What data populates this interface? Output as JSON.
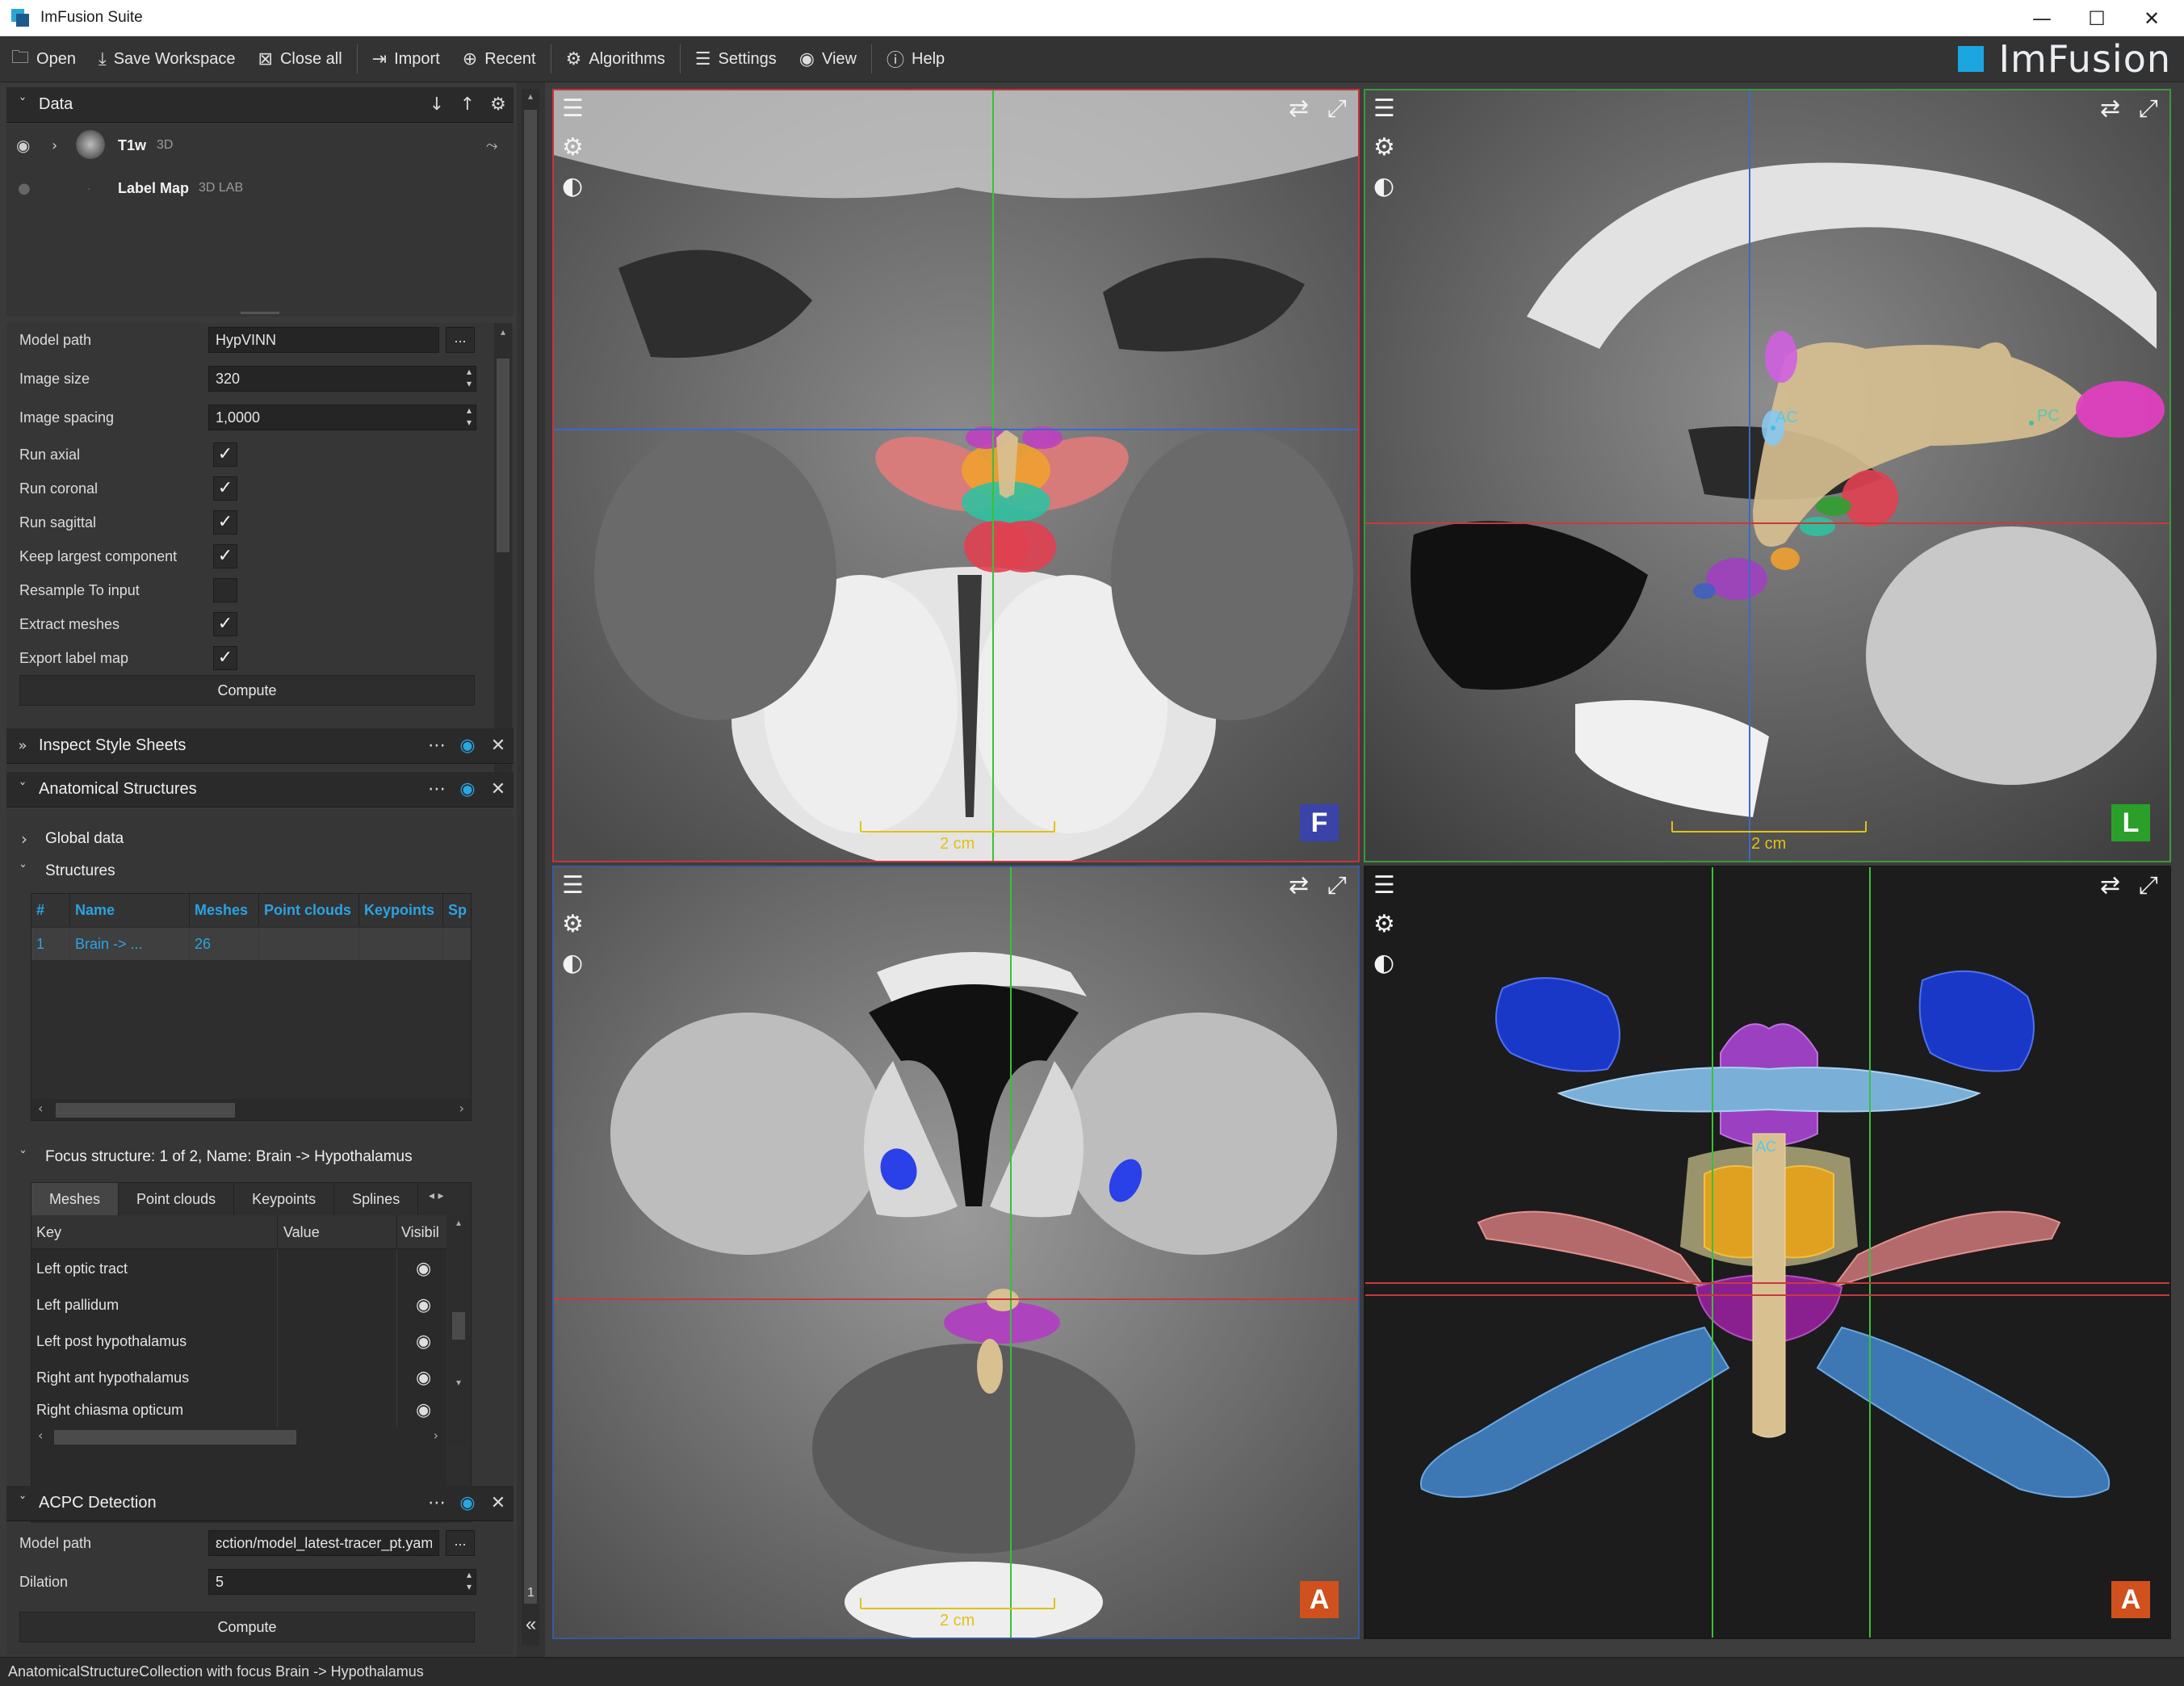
{
  "window": {
    "title": "ImFusion Suite",
    "minimize": "—",
    "maximize": "☐",
    "close": "✕"
  },
  "brand": {
    "name": "ImFusion",
    "accent": "#1ba6e0"
  },
  "toolbar": {
    "open": "Open",
    "save_workspace": "Save Workspace",
    "close_all": "Close all",
    "import": "Import",
    "recent": "Recent",
    "algorithms": "Algorithms",
    "settings": "Settings",
    "view": "View",
    "help": "Help"
  },
  "data_panel": {
    "title": "Data",
    "items": [
      {
        "name": "T1w",
        "tag": "3D",
        "icon": "brain-thumbnail-icon"
      },
      {
        "name": "Label Map",
        "tag": "3D LAB"
      }
    ]
  },
  "hypvinn": {
    "model_path_label": "Model path",
    "model_path": "HypVINN",
    "image_size_label": "Image size",
    "image_size": "320",
    "image_spacing_label": "Image spacing",
    "image_spacing": "1,0000",
    "options": [
      {
        "label": "Run axial",
        "checked": true
      },
      {
        "label": "Run coronal",
        "checked": true
      },
      {
        "label": "Run sagittal",
        "checked": true
      },
      {
        "label": "Keep largest component",
        "checked": true
      },
      {
        "label": "Resample To input",
        "checked": false
      },
      {
        "label": "Extract meshes",
        "checked": true
      },
      {
        "label": "Export label map",
        "checked": true
      }
    ],
    "compute": "Compute",
    "browse": "..."
  },
  "inspect": {
    "title": "Inspect Style Sheets"
  },
  "anatomical": {
    "title": "Anatomical Structures",
    "global_data": "Global data",
    "structures": "Structures",
    "columns": [
      "#",
      "Name",
      "Meshes",
      "Point clouds",
      "Keypoints",
      "Sp"
    ],
    "rows": [
      {
        "num": "1",
        "name": "Brain -> ...",
        "meshes": "26"
      }
    ],
    "focus": "Focus structure: 1 of 2, Name: Brain -> Hypothalamus",
    "tabs": [
      "Meshes",
      "Point clouds",
      "Keypoints",
      "Splines"
    ],
    "kv_columns": [
      "Key",
      "Value",
      "Visibil"
    ],
    "kv_rows": [
      "Left optic tract",
      "Left pallidum",
      "Left post hypothalamus",
      "Right ant hypothalamus",
      "Right chiasma opticum"
    ]
  },
  "acpc": {
    "title": "ACPC Detection",
    "model_path_label": "Model path",
    "model_path": "ɛction/model_latest-tracer_pt.yaml",
    "dilation_label": "Dilation",
    "dilation": "5",
    "compute": "Compute",
    "browse": "..."
  },
  "strip": {
    "page": "1"
  },
  "viewports": {
    "scale_label": "2 cm",
    "ac_label": "AC",
    "pc_label": "PC",
    "orient": {
      "top_left": "F",
      "top_right": "L",
      "bottom_left": "A",
      "bottom_right": "A"
    },
    "colors": {
      "coronal_border": "#c8333a",
      "sagittal_border": "#3a9a3a",
      "axial_border": "#3a5aa0",
      "orient_f": "#3a43a8",
      "orient_l": "#2aa02a",
      "orient_a": "#d0501e"
    }
  },
  "status": "AnatomicalStructureCollection with focus Brain -> Hypothalamus"
}
